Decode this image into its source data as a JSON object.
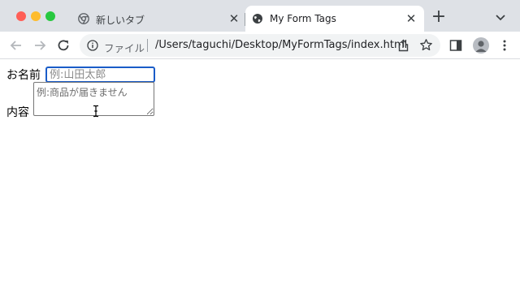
{
  "tabs": [
    {
      "label": "新しいタブ",
      "favicon": "chrome-icon",
      "active": false
    },
    {
      "label": "My Form Tags",
      "favicon": "globe-icon",
      "active": true
    }
  ],
  "toolbar": {
    "security_label": "ファイル",
    "url": "/Users/taguchi/Desktop/MyFormTags/index.html"
  },
  "form": {
    "name_label": "お名前",
    "name_placeholder": "例:山田太郎",
    "content_label": "内容",
    "content_placeholder": "例:商品が届きません"
  },
  "colors": {
    "tabstrip_bg": "#dee1e6",
    "focus_ring": "#1a5cc8",
    "traffic_close": "#ff5f57",
    "traffic_min": "#febc2e",
    "traffic_max": "#28c840"
  }
}
